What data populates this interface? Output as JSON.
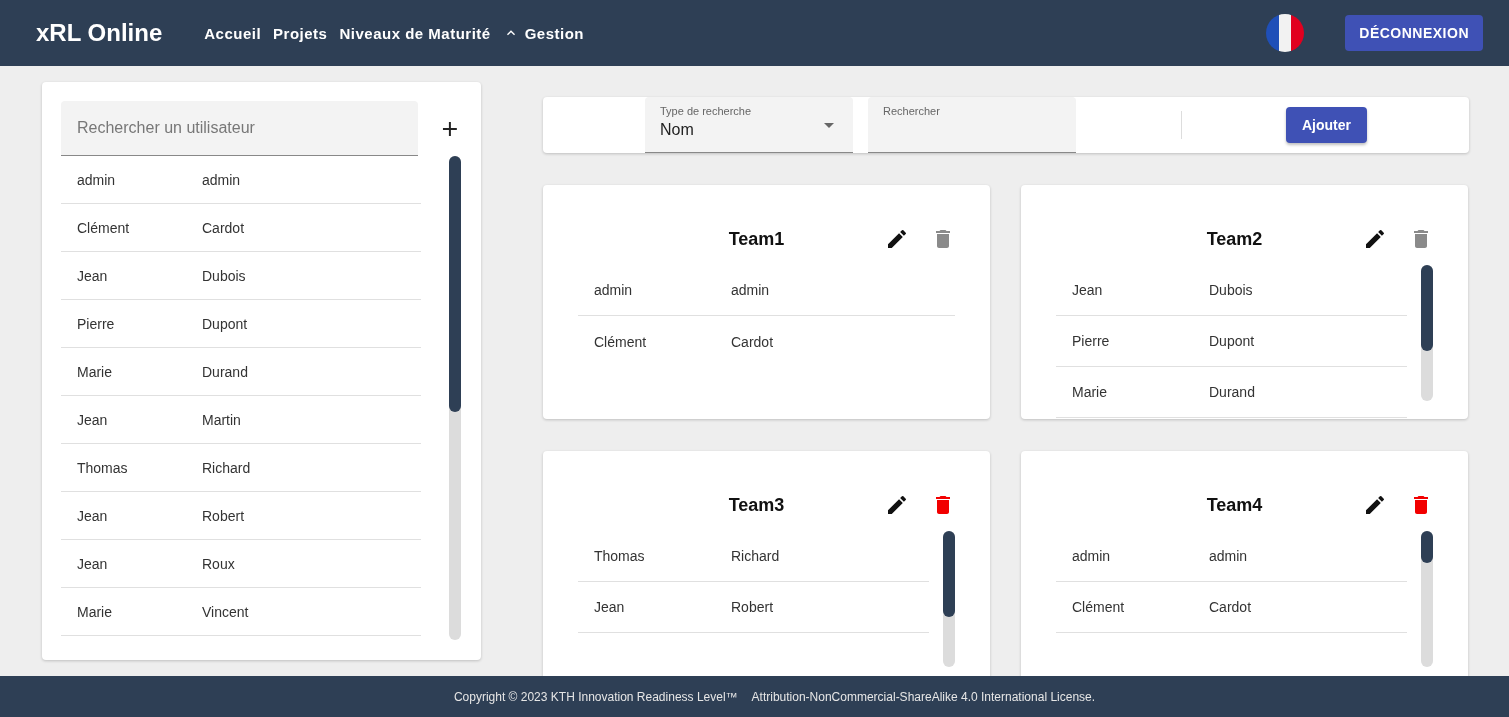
{
  "header": {
    "brand": "xRL Online",
    "nav": [
      {
        "label": "Accueil",
        "kind": "link"
      },
      {
        "label": "Projets",
        "kind": "link"
      },
      {
        "label": "Niveaux de Maturité",
        "kind": "link"
      },
      {
        "label": "Gestion",
        "kind": "menu"
      }
    ],
    "logout": "DÉCONNEXION"
  },
  "users": {
    "placeholder": "Rechercher un utilisateur",
    "rows": [
      {
        "first": "admin",
        "last": "admin"
      },
      {
        "first": "Clément",
        "last": "Cardot"
      },
      {
        "first": "Jean",
        "last": "Dubois"
      },
      {
        "first": "Pierre",
        "last": "Dupont"
      },
      {
        "first": "Marie",
        "last": "Durand"
      },
      {
        "first": "Jean",
        "last": "Martin"
      },
      {
        "first": "Thomas",
        "last": "Richard"
      },
      {
        "first": "Jean",
        "last": "Robert"
      },
      {
        "first": "Jean",
        "last": "Roux"
      },
      {
        "first": "Marie",
        "last": "Vincent"
      }
    ]
  },
  "toolbar": {
    "type_label": "Type de recherche",
    "type_value": "Nom",
    "search_label": "Rechercher",
    "add": "Ajouter"
  },
  "teams": [
    {
      "name": "Team1",
      "deletable": false,
      "scrollable": false,
      "members": [
        {
          "first": "admin",
          "last": "admin"
        },
        {
          "first": "Clément",
          "last": "Cardot"
        }
      ]
    },
    {
      "name": "Team2",
      "deletable": false,
      "scrollable": true,
      "members": [
        {
          "first": "Jean",
          "last": "Dubois"
        },
        {
          "first": "Pierre",
          "last": "Dupont"
        },
        {
          "first": "Marie",
          "last": "Durand"
        }
      ]
    },
    {
      "name": "Team3",
      "deletable": true,
      "scrollable": true,
      "members": [
        {
          "first": "Thomas",
          "last": "Richard"
        },
        {
          "first": "Jean",
          "last": "Robert"
        }
      ]
    },
    {
      "name": "Team4",
      "deletable": true,
      "scrollable": true,
      "members": [
        {
          "first": "admin",
          "last": "admin"
        },
        {
          "first": "Clément",
          "last": "Cardot"
        }
      ]
    }
  ],
  "footer": {
    "copyright": "Copyright © 2023 KTH Innovation Readiness Level™",
    "license": "Attribution-NonCommercial-ShareAlike 4.0 International License."
  }
}
